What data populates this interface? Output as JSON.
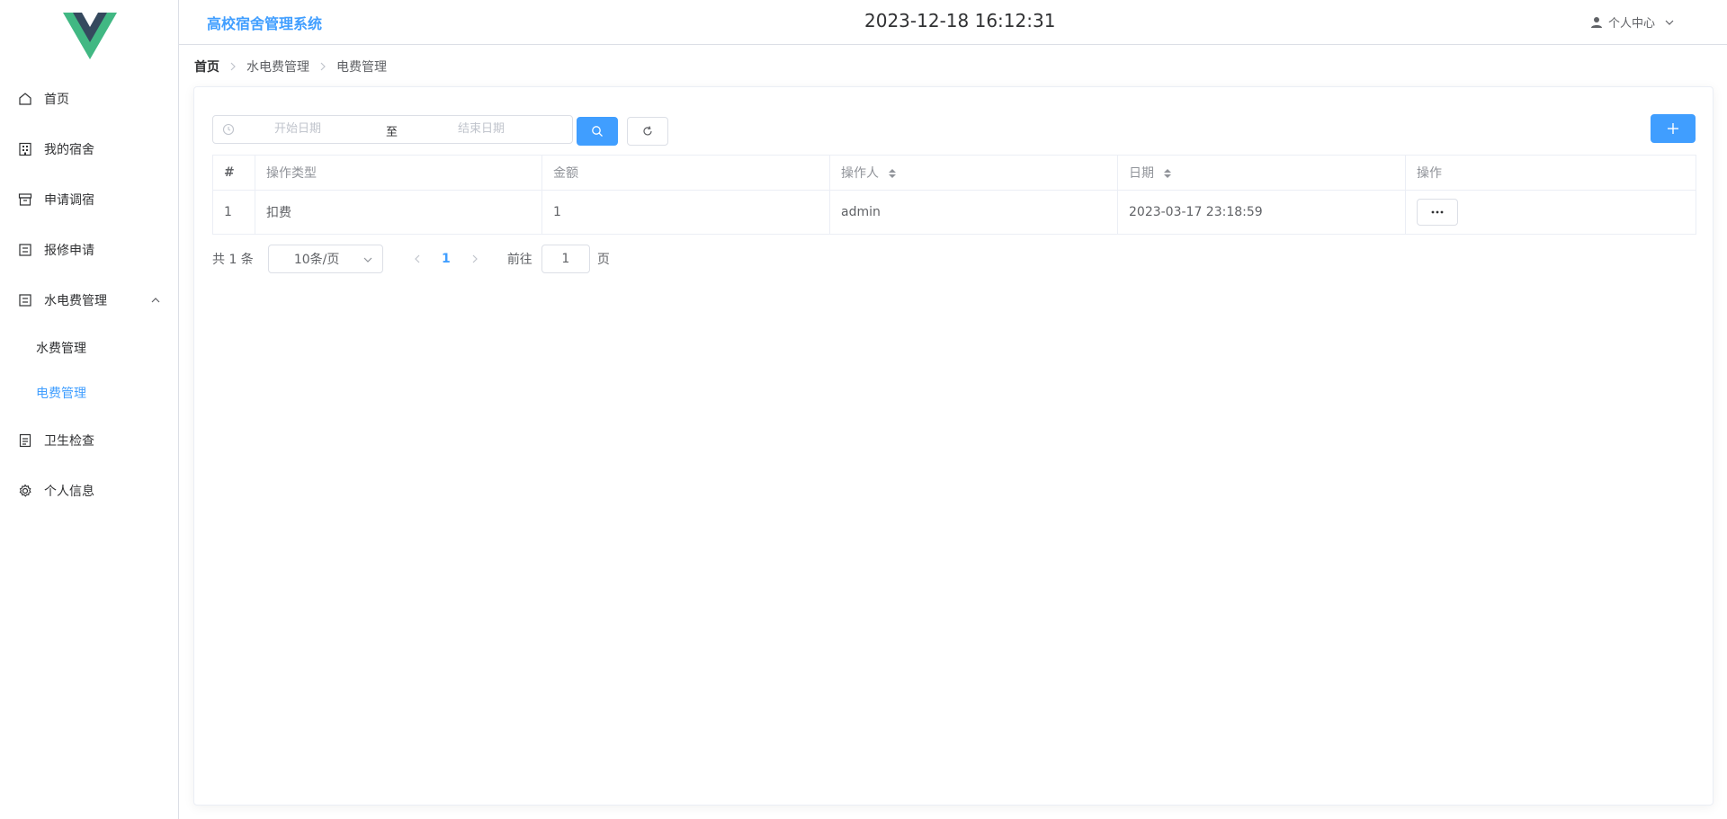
{
  "header": {
    "app_title": "高校宿舍管理系统",
    "clock": "2023-12-18 16:12:31",
    "user_center": "个人中心"
  },
  "sidebar": {
    "items": [
      {
        "label": "首页",
        "icon": "home-icon"
      },
      {
        "label": "我的宿舍",
        "icon": "building-icon"
      },
      {
        "label": "申请调宿",
        "icon": "box-icon"
      },
      {
        "label": "报修申请",
        "icon": "tickets-icon"
      },
      {
        "label": "水电费管理",
        "icon": "tickets-icon",
        "expanded": true
      },
      {
        "label": "卫生检查",
        "icon": "document-icon"
      },
      {
        "label": "个人信息",
        "icon": "gear-icon"
      }
    ],
    "submenu": [
      {
        "label": "水费管理",
        "active": false
      },
      {
        "label": "电费管理",
        "active": true
      }
    ]
  },
  "breadcrumb": [
    "首页",
    "水电费管理",
    "电费管理"
  ],
  "filter": {
    "start_placeholder": "开始日期",
    "separator": "至",
    "end_placeholder": "结束日期"
  },
  "table": {
    "headers": [
      "#",
      "操作类型",
      "金额",
      "操作人",
      "日期",
      "操作"
    ],
    "rows": [
      {
        "index": "1",
        "type": "扣费",
        "amount": "1",
        "operator": "admin",
        "date": "2023-03-17 23:18:59"
      }
    ]
  },
  "pagination": {
    "total": "共 1 条",
    "page_size": "10条/页",
    "current_page": "1",
    "goto_label": "前往",
    "goto_value": "1",
    "page_suffix": "页"
  },
  "colors": {
    "primary": "#409eff",
    "logo_green": "#41b883",
    "logo_dark": "#35495e"
  }
}
